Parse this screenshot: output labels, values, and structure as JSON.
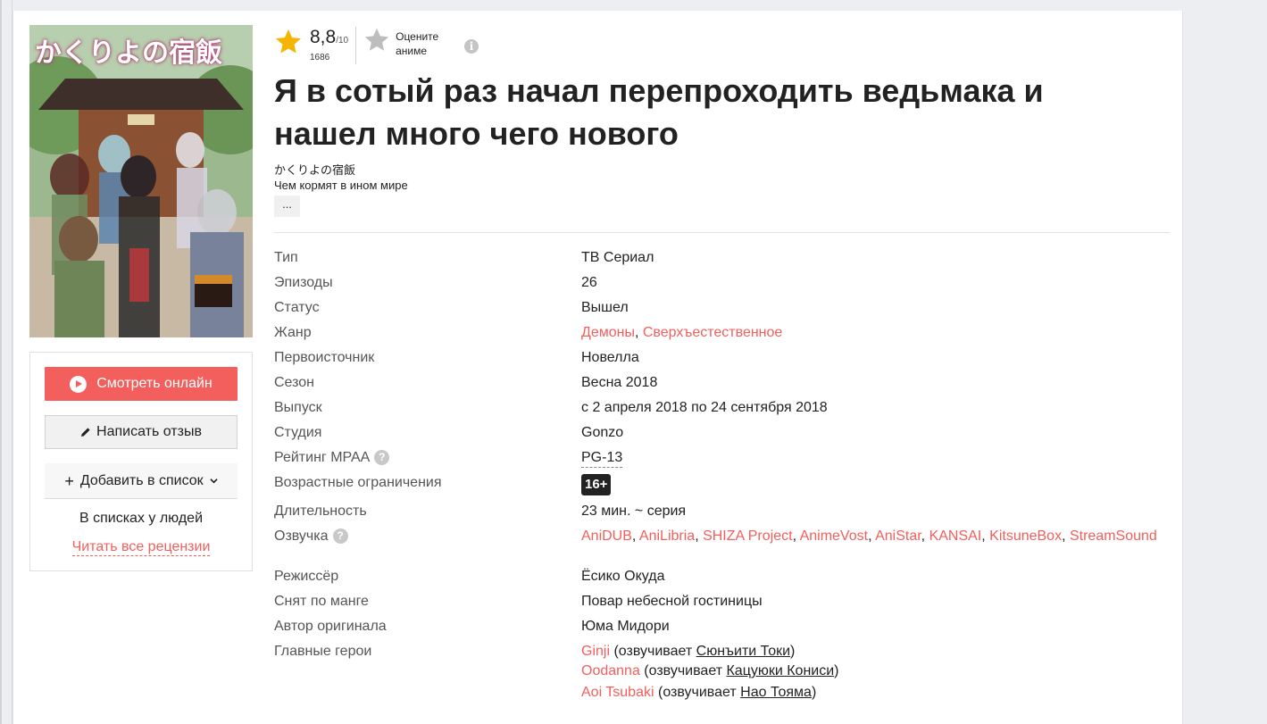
{
  "poster": {
    "logo_text": "かくりよの宿飯",
    "colors": {
      "sky": "#a9c7a2",
      "roof": "#3e2f2a",
      "building": "#8a5232",
      "ground": "#c7b9a3"
    }
  },
  "actions": {
    "watch_online": "Смотреть онлайн",
    "write_review": "Написать отзыв",
    "add_to_list": "Добавить в список",
    "in_lists": "В списках у людей",
    "read_all_reviews": "Читать все рецензии"
  },
  "rating": {
    "score": "8,8",
    "scale": "/10",
    "votes": "1686",
    "rate_label_line1": "Оцените",
    "rate_label_line2": "аниме",
    "info_icon": "i"
  },
  "title": {
    "main": "Я в сотый раз начал перепроходить ведьмака и нашел много чего нового",
    "original": "かくりよの宿飯",
    "alternative": "Чем кормят в ином мире",
    "more": "..."
  },
  "info": {
    "type": {
      "label": "Тип",
      "value": "ТВ Сериал"
    },
    "episodes": {
      "label": "Эпизоды",
      "value": "26"
    },
    "status": {
      "label": "Статус",
      "value": "Вышел"
    },
    "genre": {
      "label": "Жанр",
      "values": [
        "Демоны",
        "Сверхъестественное"
      ]
    },
    "source": {
      "label": "Первоисточник",
      "value": "Новелла"
    },
    "season": {
      "label": "Сезон",
      "value": "Весна 2018"
    },
    "release": {
      "label": "Выпуск",
      "value": "с 2 апреля 2018 по 24 сентября 2018"
    },
    "studio": {
      "label": "Студия",
      "value": "Gonzo"
    },
    "mpaa": {
      "label": "Рейтинг MPAA",
      "value": "PG-13",
      "help": "?"
    },
    "age": {
      "label": "Возрастные ограничения",
      "value": "16+"
    },
    "duration": {
      "label": "Длительность",
      "value": "23 мин. ~ серия"
    },
    "voiceover": {
      "label": "Озвучка",
      "help": "?",
      "values": [
        "AniDUB",
        "AniLibria",
        "SHIZA Project",
        "AnimeVost",
        "AniStar",
        "KANSAI",
        "KitsuneBox",
        "StreamSound"
      ]
    },
    "director": {
      "label": "Режиссёр",
      "value": "Ёсико Окуда"
    },
    "manga": {
      "label": "Снят по манге",
      "value": "Повар небесной гостиницы"
    },
    "author": {
      "label": "Автор оригинала",
      "value": "Юма Мидори"
    },
    "characters": {
      "label": "Главные герои",
      "voiced_by_prefix": "(озвучивает ",
      "suffix": ")",
      "items": [
        {
          "name": "Ginji",
          "actor": "Сюнъити Токи"
        },
        {
          "name": "Oodanna",
          "actor": "Кацуюки Кониси"
        },
        {
          "name": "Aoi Tsubaki",
          "actor": "Нао Тояма"
        }
      ]
    }
  },
  "colors": {
    "accent": "#f25f5c",
    "star": "#f5b400",
    "star_inactive": "#bdbdbd"
  }
}
